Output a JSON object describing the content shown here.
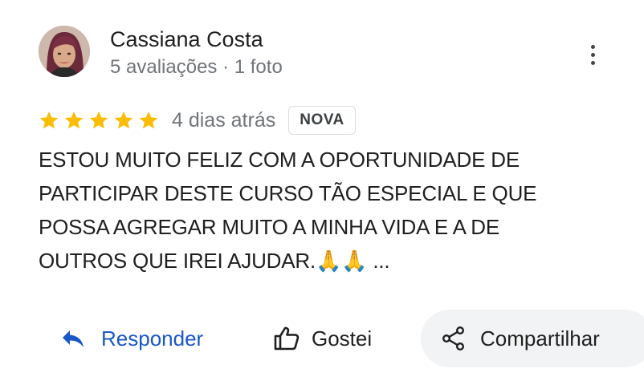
{
  "reviewer": {
    "name": "Cassiana Costa",
    "meta": "5 avaliações · 1 foto"
  },
  "review": {
    "stars": 5,
    "star_color": "#fbbc04",
    "date": "4 dias atrás",
    "badge": "NOVA",
    "text": "ESTOU MUITO FELIZ COM A OPORTUNIDADE DE\nPARTICIPAR DESTE CURSO TÃO ESPECIAL E QUE\nPOSSA AGREGAR MUITO A MINHA VIDA E A DE\nOUTROS QUE IREI AJUDAR.🙏🙏 ..."
  },
  "actions": {
    "reply_label": "Responder",
    "like_label": "Gostei",
    "share_label": "Compartilhar"
  },
  "colors": {
    "reply": "#1a57c8",
    "secondary_text": "#70757a",
    "share_bg": "#f1f3f4"
  },
  "icons": [
    "more-vertical-icon",
    "star-icon",
    "reply-arrow-icon",
    "thumbs-up-icon",
    "share-icon"
  ]
}
